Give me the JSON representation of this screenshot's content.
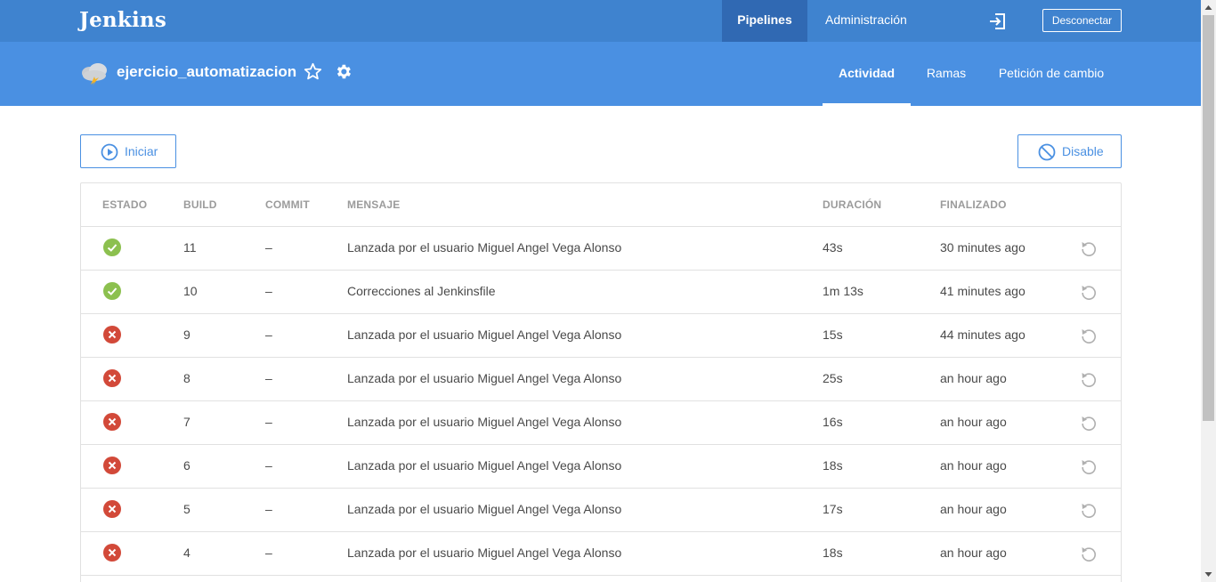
{
  "header": {
    "logo": "Jenkins",
    "nav": {
      "pipelines": "Pipelines",
      "admin": "Administración"
    },
    "logout_icon": "logout-icon",
    "logout_label": "Desconectar"
  },
  "pipeline": {
    "name": "ejercicio_automatizacion",
    "weather_icon": "stormy-weather-icon",
    "tabs": {
      "activity": "Actividad",
      "branches": "Ramas",
      "pull_requests": "Petición de cambio"
    }
  },
  "actions": {
    "run_label": "Iniciar",
    "disable_label": "Disable"
  },
  "colors": {
    "header": "#3f83cf",
    "subheader": "#4a90e2",
    "active_nav": "#3069b3",
    "success": "#8cc04f",
    "failure": "#d24939"
  },
  "table": {
    "headers": {
      "status": "ESTADO",
      "build": "BUILD",
      "commit": "COMMIT",
      "message": "MENSAJE",
      "duration": "DURACIÓN",
      "finished": "FINALIZADO"
    },
    "rows": [
      {
        "status": "success",
        "build": "11",
        "commit": "–",
        "message": "Lanzada por el usuario Miguel Angel Vega Alonso",
        "duration": "43s",
        "finished": "30 minutes ago"
      },
      {
        "status": "success",
        "build": "10",
        "commit": "–",
        "message": "Correcciones al Jenkinsfile",
        "duration": "1m 13s",
        "finished": "41 minutes ago"
      },
      {
        "status": "failure",
        "build": "9",
        "commit": "–",
        "message": "Lanzada por el usuario Miguel Angel Vega Alonso",
        "duration": "15s",
        "finished": "44 minutes ago"
      },
      {
        "status": "failure",
        "build": "8",
        "commit": "–",
        "message": "Lanzada por el usuario Miguel Angel Vega Alonso",
        "duration": "25s",
        "finished": "an hour ago"
      },
      {
        "status": "failure",
        "build": "7",
        "commit": "–",
        "message": "Lanzada por el usuario Miguel Angel Vega Alonso",
        "duration": "16s",
        "finished": "an hour ago"
      },
      {
        "status": "failure",
        "build": "6",
        "commit": "–",
        "message": "Lanzada por el usuario Miguel Angel Vega Alonso",
        "duration": "18s",
        "finished": "an hour ago"
      },
      {
        "status": "failure",
        "build": "5",
        "commit": "–",
        "message": "Lanzada por el usuario Miguel Angel Vega Alonso",
        "duration": "17s",
        "finished": "an hour ago"
      },
      {
        "status": "failure",
        "build": "4",
        "commit": "–",
        "message": "Lanzada por el usuario Miguel Angel Vega Alonso",
        "duration": "18s",
        "finished": "an hour ago"
      }
    ]
  }
}
